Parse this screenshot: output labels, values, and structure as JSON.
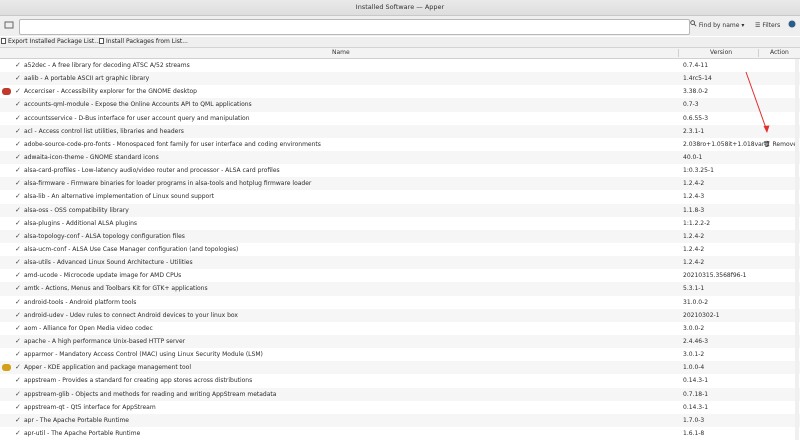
{
  "window": {
    "title": "Installed Software — Apper"
  },
  "toolbar": {
    "search_value": "",
    "find_by": "Find by name",
    "filters": "Filters"
  },
  "actions": {
    "export": "Export Installed Package List...",
    "install": "Install Packages from List..."
  },
  "columns": {
    "name": "Name",
    "version": "Version",
    "action": "Action"
  },
  "remove_label": "Remove",
  "colors": {
    "arrow": "#e03030",
    "check": "#4a4a4a"
  },
  "packages": [
    {
      "name": "a52dec",
      "desc": "A free library for decoding ATSC A/52 streams",
      "version": "0.7.4-11"
    },
    {
      "name": "aalib",
      "desc": "A portable ASCII art graphic library",
      "version": "1.4rc5-14"
    },
    {
      "name": "Accerciser",
      "desc": "Accessibility explorer for the GNOME desktop",
      "version": "3.38.0-2"
    },
    {
      "name": "accounts-qml-module",
      "desc": "Expose the Online Accounts API to QML applications",
      "version": "0.7-3"
    },
    {
      "name": "accountsservice",
      "desc": "D-Bus interface for user account query and manipulation",
      "version": "0.6.55-3"
    },
    {
      "name": "acl",
      "desc": "Access control list utilities, libraries and headers",
      "version": "2.3.1-1"
    },
    {
      "name": "adobe-source-code-pro-fonts",
      "desc": "Monospaced font family for user interface and coding environments",
      "version": "2.038ro+1.058it+1.018var-1"
    },
    {
      "name": "adwaita-icon-theme",
      "desc": "GNOME standard icons",
      "version": "40.0-1"
    },
    {
      "name": "alsa-card-profiles",
      "desc": "Low-latency audio/video router and processor - ALSA card profiles",
      "version": "1:0.3.25-1"
    },
    {
      "name": "alsa-firmware",
      "desc": "Firmware binaries for loader programs in alsa-tools and hotplug firmware loader",
      "version": "1.2.4-2"
    },
    {
      "name": "alsa-lib",
      "desc": "An alternative implementation of Linux sound support",
      "version": "1.2.4-3"
    },
    {
      "name": "alsa-oss",
      "desc": "OSS compatibility library",
      "version": "1.1.8-3"
    },
    {
      "name": "alsa-plugins",
      "desc": "Additional ALSA plugins",
      "version": "1:1.2.2-2"
    },
    {
      "name": "alsa-topology-conf",
      "desc": "ALSA topology configuration files",
      "version": "1.2.4-2"
    },
    {
      "name": "alsa-ucm-conf",
      "desc": "ALSA Use Case Manager configuration (and topologies)",
      "version": "1.2.4-2"
    },
    {
      "name": "alsa-utils",
      "desc": "Advanced Linux Sound Architecture - Utilities",
      "version": "1.2.4-2"
    },
    {
      "name": "amd-ucode",
      "desc": "Microcode update image for AMD CPUs",
      "version": "20210315.3568f96-1"
    },
    {
      "name": "amtk",
      "desc": "Actions, Menus and Toolbars Kit for GTK+ applications",
      "version": "5.3.1-1"
    },
    {
      "name": "android-tools",
      "desc": "Android platform tools",
      "version": "31.0.0-2"
    },
    {
      "name": "android-udev",
      "desc": "Udev rules to connect Android devices to your linux box",
      "version": "20210302-1"
    },
    {
      "name": "aom",
      "desc": "Alliance for Open Media video codec",
      "version": "3.0.0-2"
    },
    {
      "name": "apache",
      "desc": "A high performance Unix-based HTTP server",
      "version": "2.4.46-3"
    },
    {
      "name": "apparmor",
      "desc": "Mandatory Access Control (MAC) using Linux Security Module (LSM)",
      "version": "3.0.1-2"
    },
    {
      "name": "Apper",
      "desc": "KDE application and package management tool",
      "version": "1.0.0-4"
    },
    {
      "name": "appstream",
      "desc": "Provides a standard for creating app stores across distributions",
      "version": "0.14.3-1"
    },
    {
      "name": "appstream-glib",
      "desc": "Objects and methods for reading and writing AppStream metadata",
      "version": "0.7.18-1"
    },
    {
      "name": "appstream-qt",
      "desc": "Qt5 interface for AppStream",
      "version": "0.14.3-1"
    },
    {
      "name": "apr",
      "desc": "The Apache Portable Runtime",
      "version": "1.7.0-3"
    },
    {
      "name": "apr-util",
      "desc": "The Apache Portable Runtime",
      "version": "1.6.1-8"
    }
  ]
}
